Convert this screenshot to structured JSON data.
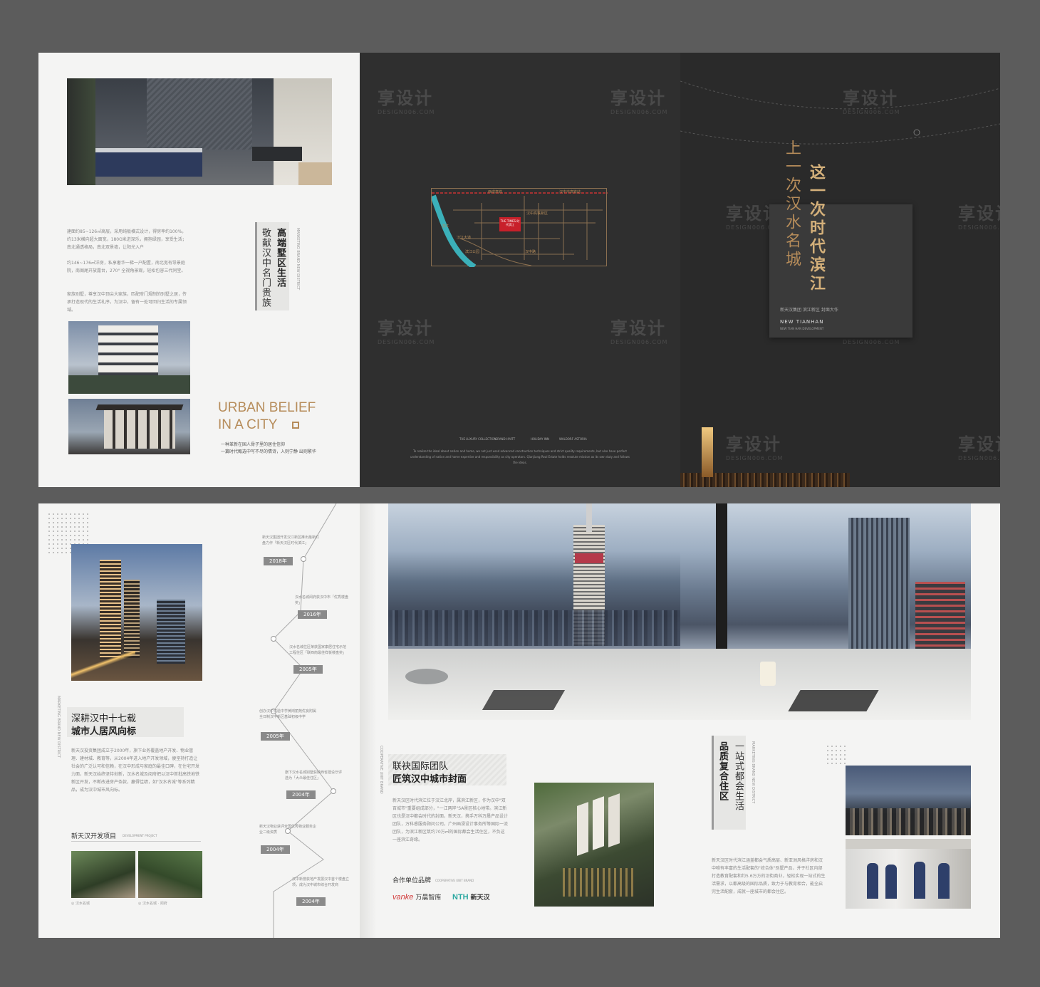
{
  "watermark": {
    "main": "享设计",
    "sub": "DESIGN006.COM"
  },
  "page1": {
    "copy1": "建面约85~126㎡高层，采用纯板横式设计，得房率约100%，约13米横向超大面宽，180O米进深乐，拥抱绿园，享受生活；南北通透格局，南北双景墙，让阳光入户",
    "copy2": "约146~176㎡洋房，私享奢华一梯一户配置，南北宽有导景庭院，南阁尾开放露台，270° 全视角景观，轻松包容三代同堂。",
    "copy3": "家族别墅，尊享汉中顶尖大家族，匹配府门规制的别墅之居，传承打造现代的生活礼序，为汉中，留有一处可回归生活的专属领域。",
    "vert_title": "高端墅区生活",
    "vert_sub": "敬献汉中名门贵族",
    "small_en": "MARKETING BRAND NEW DISTRICT",
    "urban_line1": "URBAN BELIEF",
    "urban_line2": "IN A CITY",
    "slogan1": "一种革新在国人骨子里的居住信仰",
    "slogan2": "一篇时代甄选中写不尽的情诗，入则宁静 出则繁华"
  },
  "page2": {
    "map_labels": [
      "西成高铁",
      "汉中市高铁站",
      "汉江",
      "THE TIMES 时代滨江",
      "汉中高铁新区",
      "汉江大道",
      "汉中路",
      "滨江路",
      "天汉大道",
      "民主街",
      "北关",
      "新兴大道",
      "南湖路",
      "滨江公园"
    ],
    "footer_en": "To realize the ideal about nation and home, we not just used advanced construction techniques and strict quality requirements, but also have perfect understanding of nation and home expertise and responsibility as city operators. Qianjiang Real Estate holds resolute mission as its own duty and follows the ideas.",
    "brands": [
      "THE LUXURY COLLECTION",
      "GRAND HYATT",
      "HOLIDAY INN",
      "WALDORF ASTORIA"
    ]
  },
  "page3": {
    "line_left": "上一次汉水名城",
    "line_right": "这一次时代滨江",
    "caption": "新天汉集团  滨江新区  封面大作",
    "brand": "NEW TIANHAN",
    "brand_sub": "NEW TIAN HAN DEVELOPMENT"
  },
  "page4": {
    "headline1": "深耕汉中十七载",
    "headline2": "城市人居风向标",
    "side_en": "MARKETING BRAND NEW DISTRICT",
    "body": "新天汉投资集团成立于2000年，旗下业务覆盖地产开发、物业管理、建材城、教育等，从2004年进入地产开发领域，便坚持打造让社会的广泛认可和信赖，在汉中形成与家庭的最佳口碑，在住宅开发力面，新天汉始终坚持创新，汉水名城及阅府把以汉中首批高铁地铁新区开发，不断改进房产条款，赢得佳绩，如\"汉水名城\"等系列精品，成为汉中城市风向标。",
    "dev_title": "新天汉开发项目",
    "dev_sub": "DEVELOPMENT PROJECT",
    "cap1": "◎ 汉水名城",
    "cap2": "◎ 汉水名城 · 阅府",
    "timeline": [
      {
        "text": "新天汉集团开发汉江新区推出最新红盘力作「新天汉区时代滨江」",
        "year": "2018年"
      },
      {
        "text": "汉水名城阅府获汉中市「优秀楼盘奖」",
        "year": "2016年"
      },
      {
        "text": "汉水名城住区荣获国家康居住宅示范工程住区「联西南最佳样板楼盘奖」",
        "year": "2005年"
      },
      {
        "text": "创办汉中实验中学黄岗丽苑优良附属全日制汉中新区基础初级中学",
        "year": "2005年"
      },
      {
        "text": "旗下汉水名城别墅获陕西省建设厅评选为「大众最佳住区」",
        "year": "2004年"
      },
      {
        "text": "新天汉物业获评全国优秀物业服务企业二级资质",
        "year": "2004年"
      },
      {
        "text": "汉中新誉获地产发展汉中首个楼盘立项，成为汉中城市综合开发商",
        "year": "2004年"
      }
    ]
  },
  "page5": {
    "headline1": "联袂国际团队",
    "headline2": "匠筑汉中城市封面",
    "side_en": "COOPERATIVE UNIT BRAND",
    "body": "新天汉区时代滨江位于汉江北岸，属滨江新区，作为汉中\"双百城市\"重要组成部分，\"一江两岸\"SA景区核心地带。滨江新区也是汉中都会时代的封面，新天汉，携手万科万晨产品设计团队，万科睿服务顾问公司，广州画浸设计事务所等国际一流团队，为滨江新区筑约70万㎡的国际都会生活住区，不负这一座滨江奇缘。",
    "partner_title": "合作单位品牌",
    "partner_sub": "COOPERATIVE UNIT BRAND",
    "logo_vanke": "vanke",
    "logo_vanke_cn": "万晨智库",
    "logo_nth": "NTH",
    "logo_nth_cn": "新天汉"
  },
  "page6": {
    "vert_title": "品质复合住区",
    "vert_sub": "一站式都会生活",
    "side_en": "MARKETING BRAND NEW DISTRICT",
    "body": "新天汉区时代滨江涵盖都会气质高层、新亚洲风格洋房和汉中唯有丰富的生活配套的\"综合体\"别墅产品，并于社区内部打造教育配套和约5.6万方的沿街商业，轻松实现一站式的生活需求，以都高级的国际品质，致力于与教育相合，能全启完生活配套，成就一座城市的都会住区。"
  },
  "colors": {
    "gold": "#b68c5a",
    "dark_bg": "#2f2f2f",
    "light_bg": "#f4f4f3",
    "teal": "#3bb0b9"
  }
}
